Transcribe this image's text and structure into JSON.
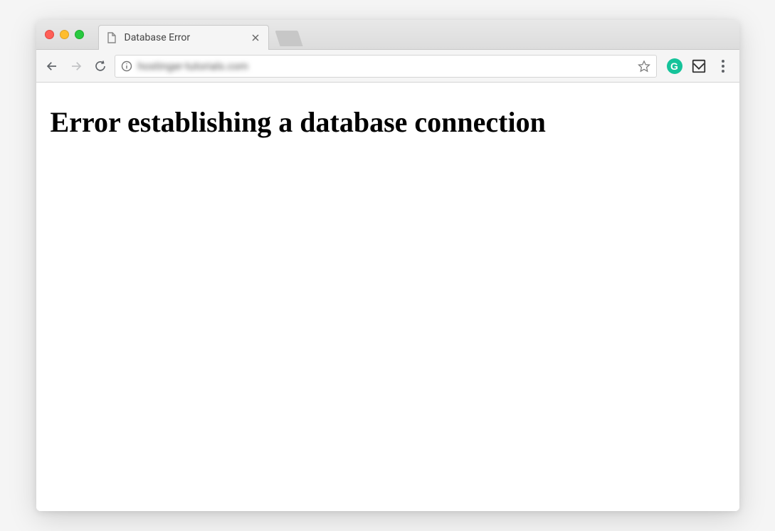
{
  "tab": {
    "title": "Database Error",
    "favicon": "page-icon"
  },
  "address_bar": {
    "url_blurred": "hostinger-tutorials.com",
    "info_icon": "info-icon",
    "star_icon": "star-icon"
  },
  "extensions": {
    "grammarly_letter": "G",
    "pocket_icon": "pocket-icon"
  },
  "page": {
    "error_heading": "Error establishing a database connection"
  }
}
